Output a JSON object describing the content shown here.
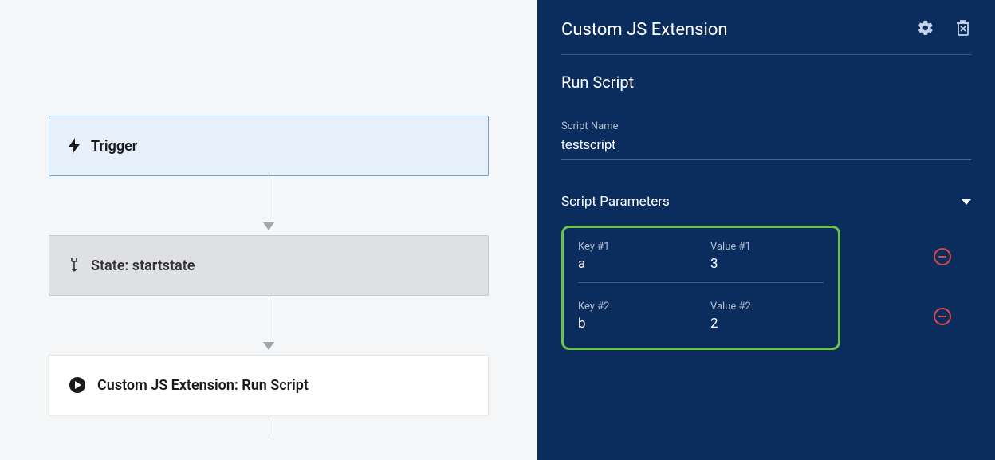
{
  "flow": {
    "trigger_label": "Trigger",
    "state_label": "State: startstate",
    "action_label": "Custom JS Extension: Run Script"
  },
  "panel": {
    "title": "Custom JS Extension",
    "subtitle": "Run Script",
    "script_name_label": "Script Name",
    "script_name_value": "testscript",
    "parameters_section_title": "Script Parameters",
    "parameters": [
      {
        "key_label": "Key #1",
        "key": "a",
        "value_label": "Value #1",
        "value": "3"
      },
      {
        "key_label": "Key #2",
        "key": "b",
        "value_label": "Value #2",
        "value": "2"
      }
    ]
  }
}
